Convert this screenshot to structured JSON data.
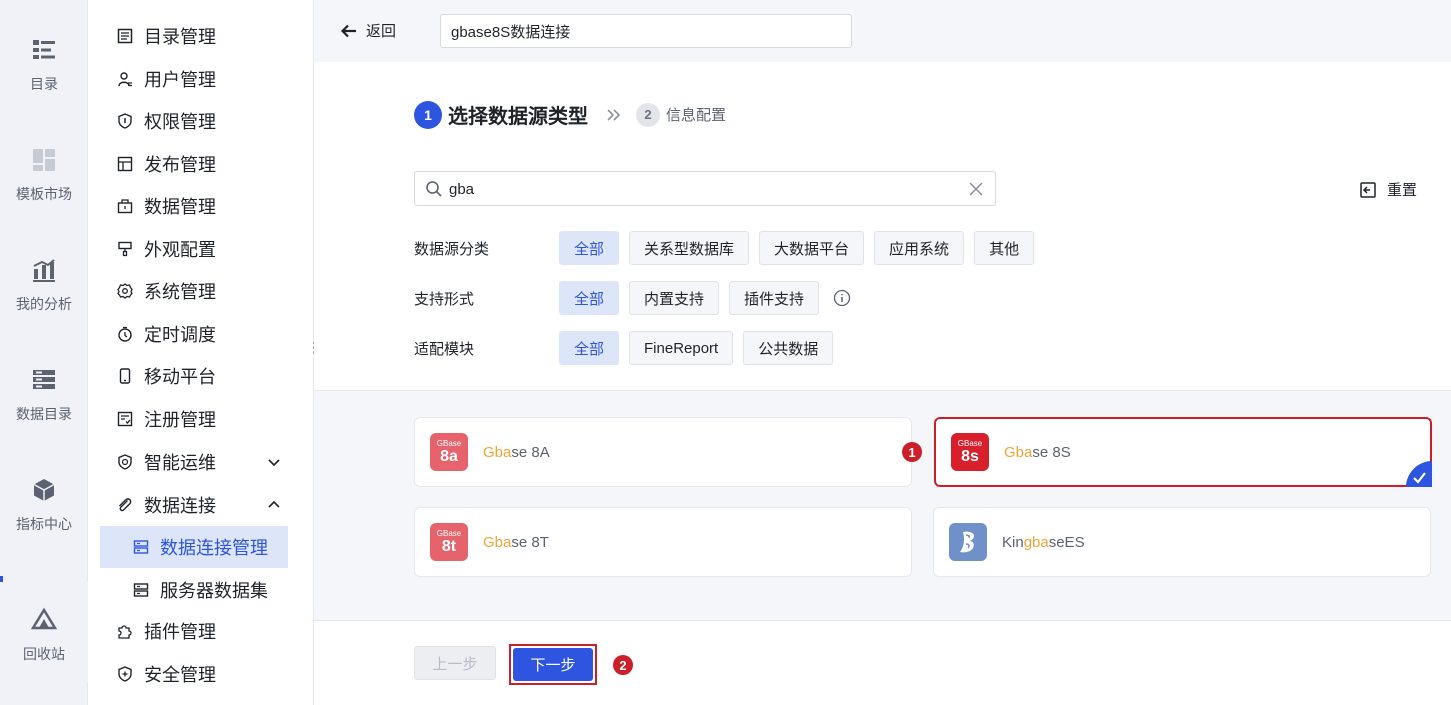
{
  "rail": {
    "items": [
      {
        "label": "目录",
        "icon": "catalog-icon"
      },
      {
        "label": "模板市场",
        "icon": "template-market-icon"
      },
      {
        "label": "我的分析",
        "icon": "analysis-icon"
      },
      {
        "label": "数据目录",
        "icon": "data-catalog-icon"
      },
      {
        "label": "指标中心",
        "icon": "metrics-center-icon"
      },
      {
        "label": "回收站",
        "icon": "recycle-bin-icon"
      }
    ]
  },
  "menu": {
    "items": [
      {
        "label": "目录管理",
        "icon": "list-icon"
      },
      {
        "label": "用户管理",
        "icon": "user-icon"
      },
      {
        "label": "权限管理",
        "icon": "shield-icon"
      },
      {
        "label": "发布管理",
        "icon": "publish-icon"
      },
      {
        "label": "数据管理",
        "icon": "data-icon"
      },
      {
        "label": "外观配置",
        "icon": "brush-icon"
      },
      {
        "label": "系统管理",
        "icon": "gear-icon"
      },
      {
        "label": "定时调度",
        "icon": "timer-icon"
      },
      {
        "label": "移动平台",
        "icon": "mobile-icon"
      },
      {
        "label": "注册管理",
        "icon": "register-icon"
      },
      {
        "label": "智能运维",
        "icon": "ops-icon"
      },
      {
        "label": "数据连接",
        "icon": "link-icon"
      },
      {
        "label": "插件管理",
        "icon": "plugin-icon"
      },
      {
        "label": "安全管理",
        "icon": "security-icon"
      }
    ],
    "sub_items": [
      {
        "label": "数据连接管理",
        "icon": "server-icon"
      },
      {
        "label": "服务器数据集",
        "icon": "server-icon"
      }
    ]
  },
  "topbar": {
    "back_label": "返回",
    "connection_name": "gbase8S数据连接"
  },
  "steps": {
    "step1_num": "1",
    "step1_label": "选择数据源类型",
    "step2_num": "2",
    "step2_label": "信息配置"
  },
  "search": {
    "value": "gba",
    "reset_label": "重置"
  },
  "filters": {
    "category": {
      "label": "数据源分类",
      "options": [
        "全部",
        "关系型数据库",
        "大数据平台",
        "应用系统",
        "其他"
      ],
      "selected": "全部"
    },
    "support": {
      "label": "支持形式",
      "options": [
        "全部",
        "内置支持",
        "插件支持"
      ],
      "selected": "全部"
    },
    "module": {
      "label": "适配模块",
      "options": [
        "全部",
        "FineReport",
        "公共数据"
      ],
      "selected": "全部"
    }
  },
  "datasources": [
    {
      "logo_top": "GBase",
      "logo_main": "8a",
      "name_hl": "Gba",
      "name_rest": "se 8A",
      "logo_color": "#e7636c",
      "selected": false
    },
    {
      "logo_top": "GBase",
      "logo_main": "8s",
      "name_hl": "Gba",
      "name_rest": "se 8S",
      "logo_color": "#d8202c",
      "selected": true
    },
    {
      "logo_top": "GBase",
      "logo_main": "8t",
      "name_hl": "Gba",
      "name_rest": "se 8T",
      "logo_color": "#e7636c",
      "selected": false
    },
    {
      "logo_top": "",
      "logo_main": "",
      "name_pre": "Kin",
      "name_hl": "gba",
      "name_rest": "seES",
      "logo_color": "#6f90c9",
      "selected": false
    }
  ],
  "annotations": {
    "badge1": "1",
    "badge2": "2"
  },
  "footer": {
    "prev_label": "上一步",
    "next_label": "下一步"
  },
  "colors": {
    "accent": "#2d55e0",
    "highlight": "#f1a536",
    "annotation_red": "#cc1f2a"
  }
}
